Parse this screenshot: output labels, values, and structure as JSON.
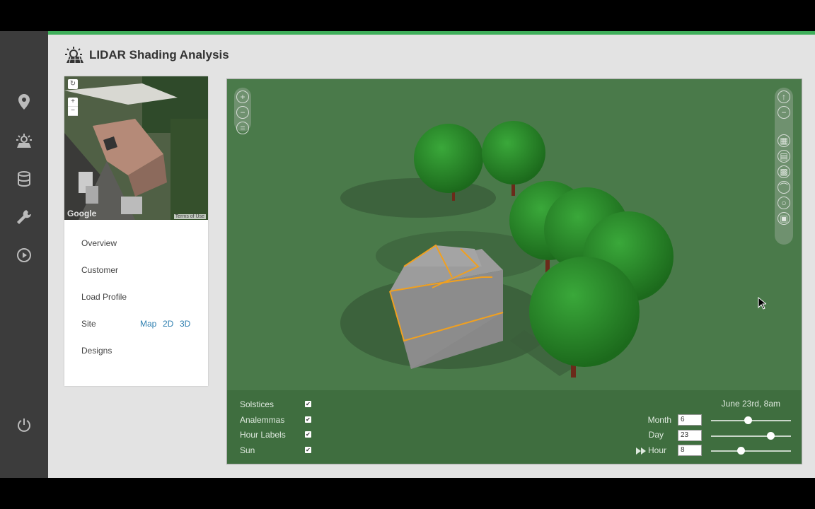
{
  "app": {
    "title": "LIDAR Shading Analysis"
  },
  "sidebar": {
    "items": [
      {
        "icon": "location-pin-icon"
      },
      {
        "icon": "solar-panel-icon"
      },
      {
        "icon": "database-icon"
      },
      {
        "icon": "wrench-icon"
      },
      {
        "icon": "play-icon"
      },
      {
        "icon": "power-icon"
      }
    ]
  },
  "map": {
    "attribution": "Terms of Use",
    "logo_text": "Google",
    "zoom_in": "+",
    "zoom_out": "−"
  },
  "nav": {
    "items": [
      "Overview",
      "Customer",
      "Load Profile",
      "Site",
      "Designs"
    ],
    "site_links": [
      "Map",
      "2D",
      "3D"
    ]
  },
  "viewer": {
    "left_controls": [
      "zoom-in-icon",
      "zoom-out-icon",
      "reset-view-icon"
    ],
    "right_controls": [
      "rotate-up-icon",
      "rotate-down-icon",
      "grid-view-icon",
      "panel-view-icon",
      "texture-view-icon",
      "arc-view-icon",
      "sphere-view-icon",
      "save-icon"
    ]
  },
  "options": {
    "checkboxes": [
      {
        "label": "Solstices",
        "checked": true
      },
      {
        "label": "Analemmas",
        "checked": true
      },
      {
        "label": "Hour Labels",
        "checked": true
      },
      {
        "label": "Sun",
        "checked": true
      }
    ],
    "date_text": "June 23rd, 8am",
    "sliders": [
      {
        "label": "Month",
        "value": "6",
        "fraction": 0.46
      },
      {
        "label": "Day",
        "value": "23",
        "fraction": 0.74
      },
      {
        "label": "Hour",
        "value": "8",
        "fraction": 0.37
      }
    ]
  },
  "colors": {
    "accent": "#3fae5a",
    "roof_outline": "#f0a020",
    "tree": "#2e8b2e",
    "ground": "#4a7a4a"
  }
}
